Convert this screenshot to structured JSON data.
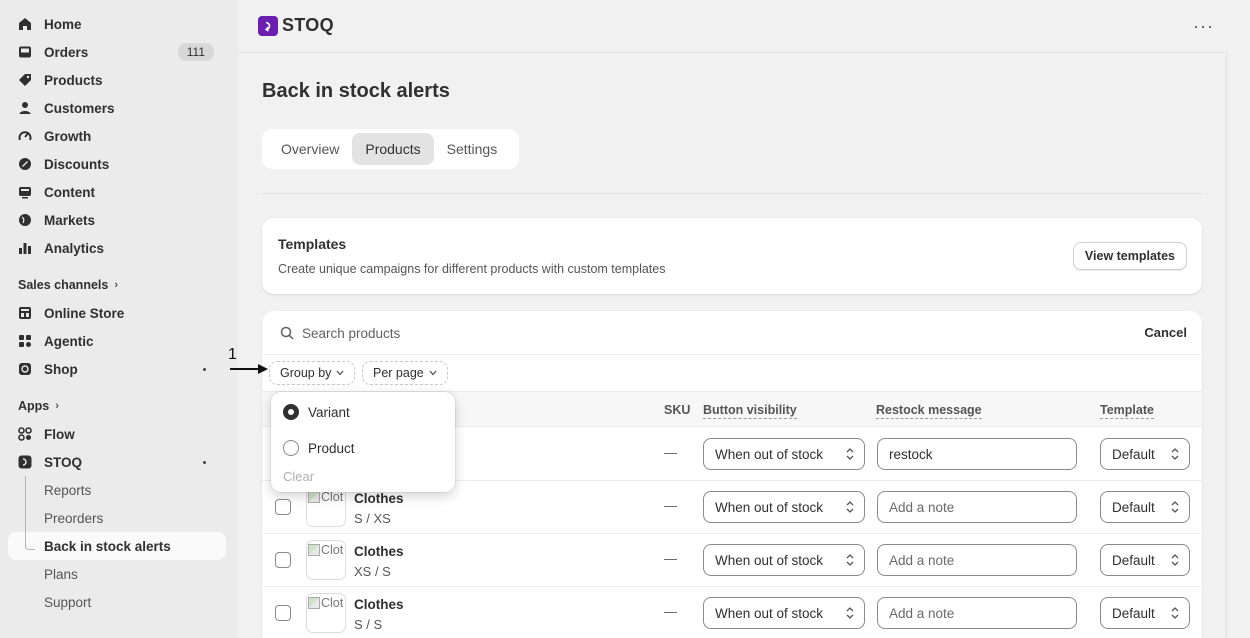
{
  "sidebar": {
    "items": [
      {
        "label": "Home",
        "icon": "home-icon"
      },
      {
        "label": "Orders",
        "icon": "inbox-icon",
        "badge": "111"
      },
      {
        "label": "Products",
        "icon": "tag-icon"
      },
      {
        "label": "Customers",
        "icon": "person-icon"
      },
      {
        "label": "Growth",
        "icon": "gauge-icon"
      },
      {
        "label": "Discounts",
        "icon": "discount-icon"
      },
      {
        "label": "Content",
        "icon": "content-icon"
      },
      {
        "label": "Markets",
        "icon": "globe-icon"
      },
      {
        "label": "Analytics",
        "icon": "bar-chart-icon"
      }
    ],
    "sales_channels_label": "Sales channels",
    "channels": [
      {
        "label": "Online Store",
        "icon": "store-icon"
      },
      {
        "label": "Agentic",
        "icon": "agentic-icon"
      },
      {
        "label": "Shop",
        "icon": "shop-icon"
      }
    ],
    "apps_label": "Apps",
    "apps": [
      {
        "label": "Flow",
        "icon": "flow-icon"
      },
      {
        "label": "STOQ",
        "icon": "stoq-icon"
      }
    ],
    "stoq_sub": [
      "Reports",
      "Preorders",
      "Back in stock alerts",
      "Plans",
      "Support"
    ]
  },
  "header": {
    "app_name": "STOQ",
    "more": "···"
  },
  "page": {
    "title": "Back in stock alerts",
    "tabs": [
      "Overview",
      "Products",
      "Settings"
    ],
    "active_tab": "Products"
  },
  "templates_card": {
    "title": "Templates",
    "description": "Create unique campaigns for different products with custom templates",
    "button": "View templates"
  },
  "search": {
    "placeholder": "Search products",
    "cancel": "Cancel"
  },
  "filters": {
    "group_by": "Group by",
    "per_page": "Per page"
  },
  "group_by_popover": {
    "options": [
      "Variant",
      "Product"
    ],
    "selected": "Variant",
    "clear": "Clear"
  },
  "table": {
    "headers": {
      "sku": "SKU",
      "button_visibility": "Button visibility",
      "restock_message": "Restock message",
      "template": "Template"
    },
    "rows": [
      {
        "name": "",
        "variant": "",
        "sku": "—",
        "visibility": "When out of stock",
        "note": "restock",
        "note_is_placeholder": false,
        "template": "Default",
        "thumb_alt": ""
      },
      {
        "name": "Clothes",
        "variant": "S / XS",
        "sku": "—",
        "visibility": "When out of stock",
        "note": "Add a note",
        "note_is_placeholder": true,
        "template": "Default",
        "thumb_alt": "Clot"
      },
      {
        "name": "Clothes",
        "variant": "XS / S",
        "sku": "—",
        "visibility": "When out of stock",
        "note": "Add a note",
        "note_is_placeholder": true,
        "template": "Default",
        "thumb_alt": "Clot"
      },
      {
        "name": "Clothes",
        "variant": "S / S",
        "sku": "—",
        "visibility": "When out of stock",
        "note": "Add a note",
        "note_is_placeholder": true,
        "template": "Default",
        "thumb_alt": "Clot"
      }
    ]
  },
  "annotation": {
    "label": "1"
  },
  "colors": {
    "accent": "#6b1fb0",
    "sidebar_bg": "#ebebeb",
    "page_bg": "#f1f1f1"
  }
}
